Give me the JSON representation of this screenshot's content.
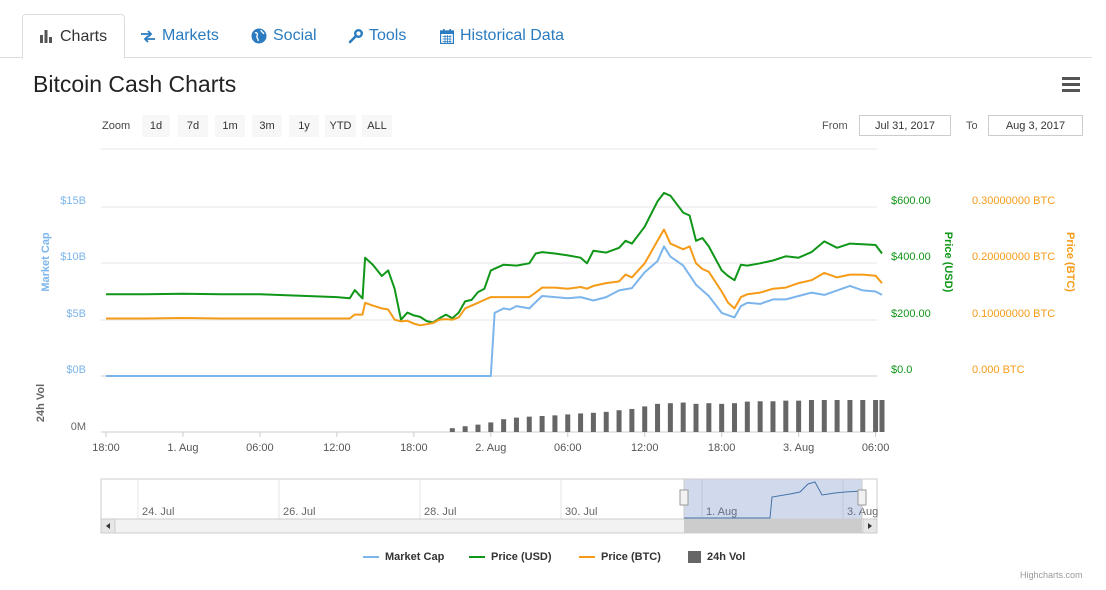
{
  "tabs": [
    {
      "label": "Charts",
      "icon": "bar-chart-icon"
    },
    {
      "label": "Markets",
      "icon": "exchange-icon"
    },
    {
      "label": "Social",
      "icon": "globe-icon"
    },
    {
      "label": "Tools",
      "icon": "wrench-icon"
    },
    {
      "label": "Historical Data",
      "icon": "calendar-icon"
    }
  ],
  "page_title": "Bitcoin Cash Charts",
  "zoom": {
    "label": "Zoom",
    "buttons": [
      "1d",
      "7d",
      "1m",
      "3m",
      "1y",
      "YTD",
      "ALL"
    ]
  },
  "range": {
    "from_label": "From",
    "from_value": "Jul 31, 2017",
    "to_label": "To",
    "to_value": "Aug 3, 2017"
  },
  "colors": {
    "market_cap": "#7cb5ec",
    "price_usd": "#109618",
    "price_btc": "#f59b18",
    "volume": "#666666",
    "tab_link": "#2a7bbf"
  },
  "chart_data": {
    "type": "line",
    "x_ticks": [
      "18:00",
      "1. Aug",
      "06:00",
      "12:00",
      "18:00",
      "2. Aug",
      "06:00",
      "12:00",
      "18:00",
      "3. Aug",
      "06:00"
    ],
    "x_tick_hours": [
      0,
      6,
      12,
      18,
      24,
      30,
      36,
      42,
      48,
      54,
      60
    ],
    "axes": {
      "market_cap": {
        "title": "Market Cap",
        "ticks": [
          "$0B",
          "$5B",
          "$10B",
          "$15B"
        ],
        "range": [
          0,
          15
        ]
      },
      "price_usd": {
        "title": "Price (USD)",
        "ticks": [
          "$0.0",
          "$200.00",
          "$400.00",
          "$600.00"
        ],
        "range": [
          0,
          600
        ]
      },
      "price_btc": {
        "title": "Price (BTC)",
        "ticks": [
          "0.000 BTC",
          "0.10000000 BTC",
          "0.20000000 BTC",
          "0.30000000 BTC"
        ],
        "range": [
          0,
          0.3
        ]
      },
      "volume": {
        "title": "24h Vol",
        "ticks": [
          "0M"
        ]
      }
    },
    "series": [
      {
        "name": "Market Cap",
        "unit": "USD billions",
        "points": [
          [
            0,
            0
          ],
          [
            30,
            0
          ],
          [
            30.3,
            5.6
          ],
          [
            31,
            6.0
          ],
          [
            31.5,
            5.9
          ],
          [
            32,
            6.2
          ],
          [
            33,
            6.0
          ],
          [
            34,
            7.1
          ],
          [
            35,
            7.0
          ],
          [
            36,
            6.9
          ],
          [
            37,
            7.0
          ],
          [
            38,
            6.7
          ],
          [
            39,
            7.0
          ],
          [
            40,
            7.6
          ],
          [
            41,
            7.8
          ],
          [
            42,
            9.2
          ],
          [
            43,
            10.2
          ],
          [
            43.5,
            11.5
          ],
          [
            44,
            10.6
          ],
          [
            45,
            9.8
          ],
          [
            46,
            8.1
          ],
          [
            47,
            7.1
          ],
          [
            48,
            5.6
          ],
          [
            49,
            5.2
          ],
          [
            49.5,
            6.2
          ],
          [
            50,
            6.5
          ],
          [
            51,
            6.4
          ],
          [
            52,
            6.8
          ],
          [
            53,
            6.8
          ],
          [
            54,
            7.1
          ],
          [
            55,
            7.4
          ],
          [
            56,
            7.2
          ],
          [
            57,
            7.6
          ],
          [
            58,
            8.0
          ],
          [
            59,
            7.6
          ],
          [
            60,
            7.5
          ],
          [
            60.5,
            7.2
          ]
        ]
      },
      {
        "name": "Price (USD)",
        "unit": "USD",
        "points": [
          [
            0,
            290
          ],
          [
            3,
            290
          ],
          [
            6,
            292
          ],
          [
            9,
            290
          ],
          [
            12,
            290
          ],
          [
            18,
            280
          ],
          [
            19,
            276
          ],
          [
            19.4,
            305
          ],
          [
            20,
            275
          ],
          [
            20.2,
            420
          ],
          [
            20.8,
            395
          ],
          [
            21.5,
            355
          ],
          [
            22,
            375
          ],
          [
            22.5,
            310
          ],
          [
            23,
            200
          ],
          [
            23.5,
            225
          ],
          [
            24,
            215
          ],
          [
            24.5,
            210
          ],
          [
            25,
            195
          ],
          [
            25.5,
            190
          ],
          [
            26,
            205
          ],
          [
            26.5,
            218
          ],
          [
            27,
            205
          ],
          [
            27.5,
            225
          ],
          [
            28,
            265
          ],
          [
            28.5,
            270
          ],
          [
            29,
            298
          ],
          [
            29.5,
            310
          ],
          [
            30,
            375
          ],
          [
            31,
            395
          ],
          [
            32,
            392
          ],
          [
            33,
            400
          ],
          [
            33.5,
            435
          ],
          [
            34,
            440
          ],
          [
            35,
            435
          ],
          [
            36,
            428
          ],
          [
            37,
            420
          ],
          [
            37.5,
            400
          ],
          [
            38,
            445
          ],
          [
            39,
            438
          ],
          [
            40,
            455
          ],
          [
            40.5,
            480
          ],
          [
            41,
            470
          ],
          [
            42,
            530
          ],
          [
            42.5,
            575
          ],
          [
            43,
            620
          ],
          [
            43.5,
            650
          ],
          [
            44,
            640
          ],
          [
            45,
            580
          ],
          [
            45.5,
            570
          ],
          [
            46,
            480
          ],
          [
            46.5,
            490
          ],
          [
            47,
            460
          ],
          [
            48,
            375
          ],
          [
            48.5,
            355
          ],
          [
            49,
            340
          ],
          [
            49.5,
            395
          ],
          [
            50,
            392
          ],
          [
            51,
            400
          ],
          [
            52,
            410
          ],
          [
            53,
            425
          ],
          [
            54,
            420
          ],
          [
            55,
            440
          ],
          [
            56,
            478
          ],
          [
            57,
            455
          ],
          [
            58,
            470
          ],
          [
            59,
            468
          ],
          [
            60,
            465
          ],
          [
            60.5,
            435
          ]
        ]
      },
      {
        "name": "Price (BTC)",
        "unit": "BTC",
        "points": [
          [
            0,
            0.102
          ],
          [
            3,
            0.102
          ],
          [
            6,
            0.103
          ],
          [
            9,
            0.102
          ],
          [
            12,
            0.102
          ],
          [
            18,
            0.102
          ],
          [
            19,
            0.102
          ],
          [
            19.4,
            0.109
          ],
          [
            20,
            0.109
          ],
          [
            20.2,
            0.13
          ],
          [
            20.8,
            0.125
          ],
          [
            21.5,
            0.12
          ],
          [
            22,
            0.118
          ],
          [
            22.5,
            0.1
          ],
          [
            23,
            0.097
          ],
          [
            23.5,
            0.098
          ],
          [
            24,
            0.093
          ],
          [
            24.5,
            0.09
          ],
          [
            25,
            0.092
          ],
          [
            25.5,
            0.094
          ],
          [
            26,
            0.1
          ],
          [
            26.5,
            0.101
          ],
          [
            27,
            0.1
          ],
          [
            27.5,
            0.104
          ],
          [
            28,
            0.12
          ],
          [
            28.5,
            0.125
          ],
          [
            29,
            0.13
          ],
          [
            29.5,
            0.135
          ],
          [
            30,
            0.14
          ],
          [
            31,
            0.14
          ],
          [
            32,
            0.14
          ],
          [
            33,
            0.14
          ],
          [
            33.5,
            0.148
          ],
          [
            34,
            0.157
          ],
          [
            35,
            0.157
          ],
          [
            36,
            0.155
          ],
          [
            37,
            0.158
          ],
          [
            37.5,
            0.155
          ],
          [
            38,
            0.16
          ],
          [
            39,
            0.165
          ],
          [
            40,
            0.168
          ],
          [
            40.5,
            0.18
          ],
          [
            41,
            0.175
          ],
          [
            42,
            0.2
          ],
          [
            42.5,
            0.22
          ],
          [
            43,
            0.24
          ],
          [
            43.5,
            0.26
          ],
          [
            44,
            0.235
          ],
          [
            45,
            0.225
          ],
          [
            45.5,
            0.23
          ],
          [
            46,
            0.2
          ],
          [
            46.5,
            0.19
          ],
          [
            47,
            0.185
          ],
          [
            48,
            0.15
          ],
          [
            48.5,
            0.13
          ],
          [
            49,
            0.12
          ],
          [
            49.5,
            0.14
          ],
          [
            50,
            0.145
          ],
          [
            51,
            0.148
          ],
          [
            52,
            0.155
          ],
          [
            53,
            0.157
          ],
          [
            54,
            0.165
          ],
          [
            55,
            0.17
          ],
          [
            56,
            0.183
          ],
          [
            57,
            0.175
          ],
          [
            58,
            0.18
          ],
          [
            59,
            0.18
          ],
          [
            60,
            0.178
          ],
          [
            60.5,
            0.165
          ]
        ]
      },
      {
        "name": "24h Vol",
        "unit": "relative",
        "bars": [
          [
            27,
            0.12
          ],
          [
            28,
            0.18
          ],
          [
            29,
            0.23
          ],
          [
            30,
            0.3
          ],
          [
            31,
            0.4
          ],
          [
            32,
            0.45
          ],
          [
            33,
            0.48
          ],
          [
            34,
            0.5
          ],
          [
            35,
            0.52
          ],
          [
            36,
            0.55
          ],
          [
            37,
            0.58
          ],
          [
            38,
            0.6
          ],
          [
            39,
            0.63
          ],
          [
            40,
            0.68
          ],
          [
            41,
            0.72
          ],
          [
            42,
            0.8
          ],
          [
            43,
            0.88
          ],
          [
            44,
            0.9
          ],
          [
            45,
            0.92
          ],
          [
            46,
            0.88
          ],
          [
            47,
            0.9
          ],
          [
            48,
            0.88
          ],
          [
            49,
            0.9
          ],
          [
            50,
            0.95
          ],
          [
            51,
            0.96
          ],
          [
            52,
            0.96
          ],
          [
            53,
            0.98
          ],
          [
            54,
            0.98
          ],
          [
            55,
            1.0
          ],
          [
            56,
            1.0
          ],
          [
            57,
            1.0
          ],
          [
            58,
            1.0
          ],
          [
            59,
            1.0
          ],
          [
            60,
            1.0
          ],
          [
            60.5,
            1.0
          ]
        ]
      }
    ],
    "navigator": {
      "ticks": [
        "24. Jul",
        "26. Jul",
        "28. Jul",
        "30. Jul",
        "1. Aug",
        "3. Aug"
      ]
    },
    "legend": [
      "Market Cap",
      "Price (USD)",
      "Price (BTC)",
      "24h Vol"
    ],
    "legend_position": "bottom-center",
    "credits": "Highcharts.com"
  }
}
